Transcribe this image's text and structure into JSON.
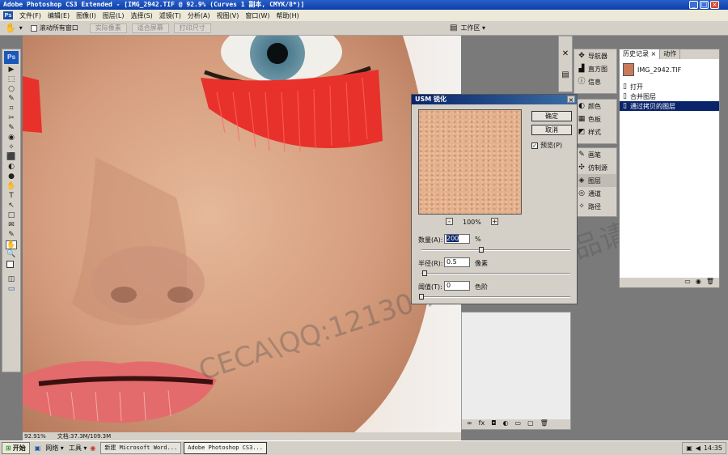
{
  "window": {
    "title": "Adobe Photoshop CS3 Extended - [IMG_2942.TIF @ 92.9% (Curves 1 副本, CMYK/8*)]",
    "buttons": [
      "_",
      "□",
      "×"
    ]
  },
  "menubar": {
    "items": [
      "文件(F)",
      "编辑(E)",
      "图像(I)",
      "图层(L)",
      "选择(S)",
      "滤镜(T)",
      "分析(A)",
      "视图(V)",
      "窗口(W)",
      "帮助(H)"
    ]
  },
  "options_bar": {
    "checkbox_label": "滚动所有窗口",
    "buttons": [
      "实际像素",
      "适合屏幕",
      "打印尺寸"
    ],
    "workspace_label": "工作区 ▾"
  },
  "tools": {
    "logo": "Ps",
    "glyphs": [
      "▶",
      "⬚",
      "○",
      "✎",
      "⌗",
      "✂",
      "✎",
      "◉",
      "✧",
      "⬛",
      "◐",
      "●",
      "✋",
      "T",
      "↖",
      "□",
      "✉",
      "✎",
      "✋",
      "🔍",
      "■",
      "◫",
      "▭"
    ]
  },
  "status": {
    "zoom": "92.91%",
    "doc": "文档:37.3M/109.3M"
  },
  "panels": {
    "group1": [
      "导航器",
      "直方图",
      "信息"
    ],
    "group2": [
      "颜色",
      "色板",
      "样式"
    ],
    "group3": [
      "画笔",
      "仿制源",
      "图层",
      "通道",
      "路径"
    ]
  },
  "history": {
    "tabs": [
      "历史记录 ×",
      "动作"
    ],
    "snapshot": "IMG_2942.TIF",
    "steps": [
      "打开",
      "合并图层",
      "通过拷贝的图层"
    ]
  },
  "dialog": {
    "title": "USM 锐化",
    "ok": "确定",
    "cancel": "取消",
    "preview_label": "预览(P)",
    "zoom": "100%",
    "amount_label": "数量(A):",
    "amount_value": "200",
    "amount_unit": "%",
    "radius_label": "半径(R):",
    "radius_value": "0.5",
    "radius_unit": "像素",
    "threshold_label": "阈值(T):",
    "threshold_value": "0",
    "threshold_unit": "色阶",
    "amount_level": 0.4,
    "radius_level": 0.02,
    "threshold_level": 0
  },
  "watermark": "CECA\\QQ:12130 7383  本人作品请勿转载",
  "taskbar": {
    "start": "开始",
    "quick": [
      "网络 ▾",
      "工具 ▾"
    ],
    "tasks": [
      "新建 Microsoft Word...",
      "Adobe Photoshop CS3..."
    ],
    "time": "14:35"
  }
}
